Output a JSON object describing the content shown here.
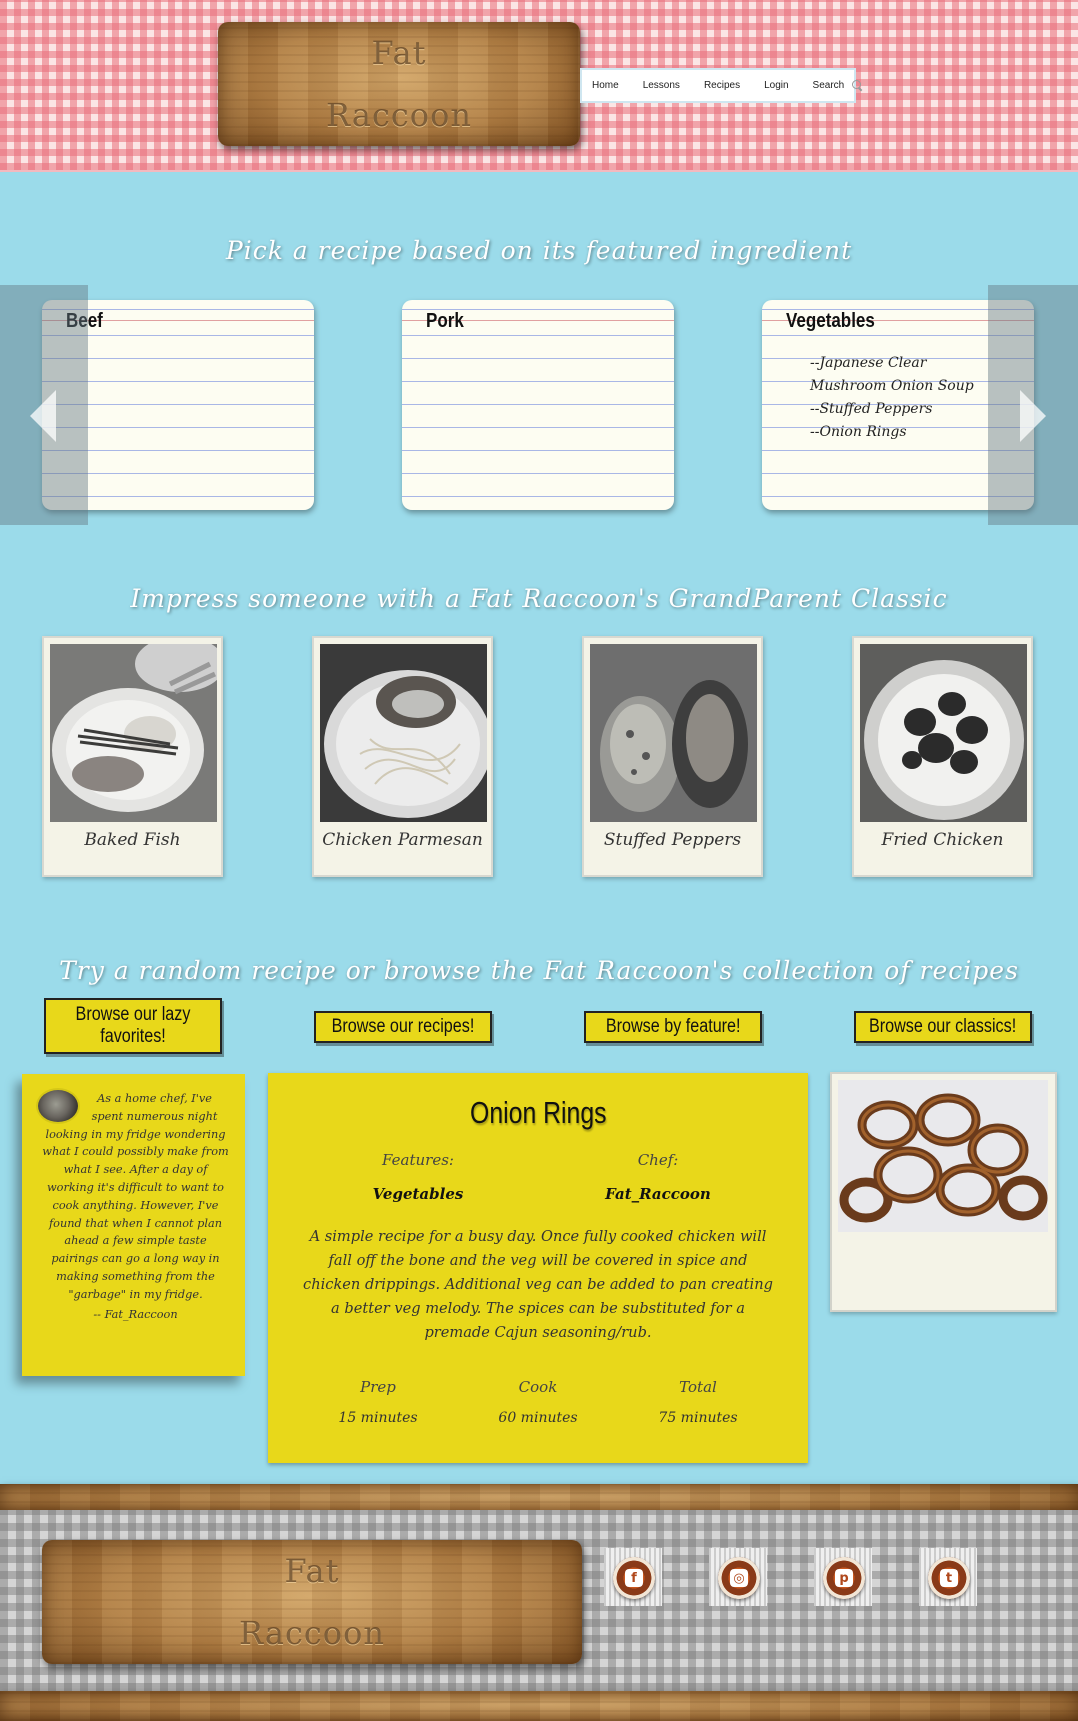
{
  "site": {
    "logo_line1": "Fat",
    "logo_line2": "Raccoon"
  },
  "nav": {
    "items": [
      "Home",
      "Lessons",
      "Recipes",
      "Login"
    ],
    "search_label": "Search"
  },
  "ingredients_section": {
    "heading": "Pick a recipe based on its featured ingredient",
    "cards": [
      {
        "title": "Beef",
        "recipes": []
      },
      {
        "title": "Pork",
        "recipes": []
      },
      {
        "title": "Vegetables",
        "recipes": [
          "--Japanese Clear",
          "Mushroom Onion Soup",
          "--Stuffed Peppers",
          "--Onion Rings"
        ]
      }
    ]
  },
  "classics_section": {
    "heading": "Impress someone with a Fat Raccoon's GrandParent Classic",
    "items": [
      {
        "caption": "Baked Fish",
        "icon": "baked-fish-photo"
      },
      {
        "caption": "Chicken Parmesan",
        "icon": "chicken-parmesan-photo"
      },
      {
        "caption": "Stuffed Peppers",
        "icon": "stuffed-peppers-photo"
      },
      {
        "caption": "Fried Chicken",
        "icon": "fried-chicken-photo"
      }
    ]
  },
  "browse_section": {
    "heading": "Try a random recipe or browse the Fat Raccoon's collection of recipes",
    "buttons": [
      "Browse our lazy favorites!",
      "Browse our recipes!",
      "Browse by feature!",
      "Browse our classics!"
    ]
  },
  "note": {
    "text": "As a home chef, I've spent numerous night looking in my fridge wondering what I could possibly make from what I see. After a day of working it's difficult to want to cook anything. However, I've found that when I cannot plan ahead a few simple taste pairings can go a long way in making something from the \"garbage\" in my fridge.",
    "signature": "-- Fat_Raccoon"
  },
  "random_recipe": {
    "title": "Onion Rings",
    "features_label": "Features:",
    "features_value": "Vegetables",
    "chef_label": "Chef:",
    "chef_value": "Fat_Raccoon",
    "description": "A simple recipe for a busy day. Once fully cooked chicken will fall off the bone and the veg will be covered in spice and chicken drippings. Additional veg can be added to pan creating a better veg melody. The spices can be substituted for a premade Cajun seasoning/rub.",
    "prep_label": "Prep",
    "prep_value": "15 minutes",
    "cook_label": "Cook",
    "cook_value": "60 minutes",
    "total_label": "Total",
    "total_value": "75 minutes"
  },
  "footer": {
    "logo_line1": "Fat",
    "logo_line2": "Raccoon",
    "social": [
      {
        "name": "facebook",
        "glyph": "f"
      },
      {
        "name": "instagram",
        "glyph": "◎"
      },
      {
        "name": "pinterest",
        "glyph": "p"
      },
      {
        "name": "twitter",
        "glyph": "t"
      }
    ]
  },
  "colors": {
    "page_background": "#9bdbea",
    "accent_yellow": "#e8d81a",
    "tablecloth_red": "#e96e7a",
    "tablecloth_gray": "#787878",
    "wood": "#b07e44"
  }
}
